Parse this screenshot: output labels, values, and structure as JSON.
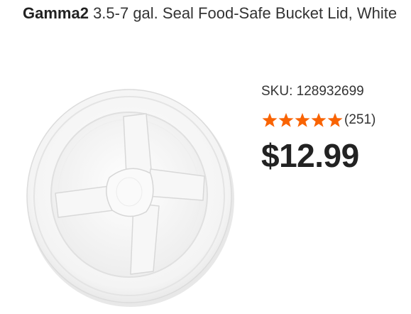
{
  "product": {
    "brand": "Gamma2",
    "name": " 3.5-7 gal. Seal Food-Safe Bucket Lid, White",
    "sku": "SKU: 128932699",
    "rating": 5,
    "rating_max": 5,
    "review_count": "(251)",
    "price": "$12.99",
    "image_icon": "bucket-lid-image"
  },
  "colors": {
    "star": "#f96302",
    "text": "#333333",
    "price": "#222222"
  }
}
